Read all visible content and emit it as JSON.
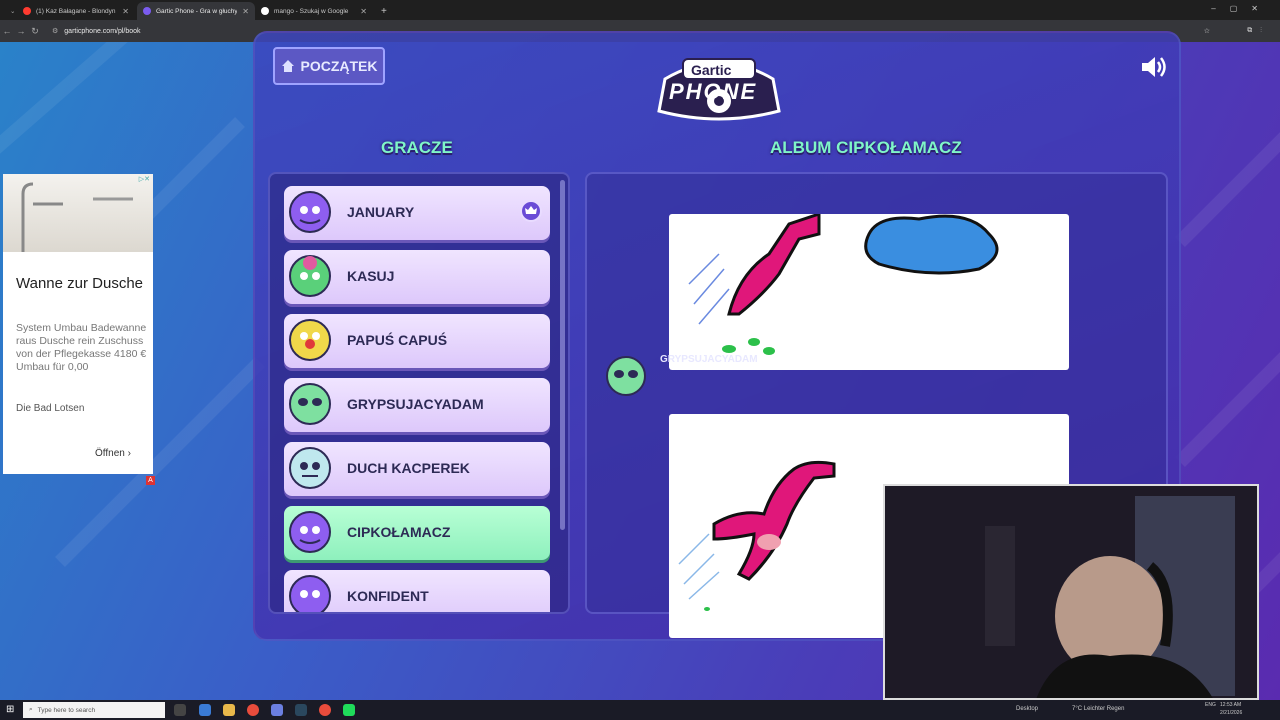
{
  "browser": {
    "tabs": [
      {
        "title": "(1) Kaz Bałagane - Blondyn",
        "color": "#ff3b30"
      },
      {
        "title": "Gartic Phone - Gra w głuchy te",
        "color": "#7b5cf0"
      },
      {
        "title": "mango - Szukaj w Google",
        "color": "#ffffff"
      }
    ],
    "new_tab": "+",
    "url": "garticphone.com/pl/book"
  },
  "game": {
    "home_label": "POCZĄTEK",
    "logo_top": "Gartic",
    "logo_bottom": "PHONE",
    "players_title": "GRACZE",
    "album_title": "ALBUM CIPKOŁAMACZ",
    "players": [
      {
        "name": "JANUARY",
        "avatar_color": "#8e5ef0",
        "host": true
      },
      {
        "name": "KASUJ",
        "avatar_color": "#5ad07a"
      },
      {
        "name": "PAPUŚ CAPUŚ",
        "avatar_color": "#f0d84a"
      },
      {
        "name": "GRYPSUJACYADAM",
        "avatar_color": "#7ee0a0"
      },
      {
        "name": "DUCH KACPEREK",
        "avatar_color": "#bfe8ee"
      },
      {
        "name": "CIPKOŁAMACZ",
        "avatar_color": "#8e5ef0",
        "selected": true
      },
      {
        "name": "KONFIDENT",
        "avatar_color": "#8e5ef0"
      }
    ],
    "album_author": "GRYPSUJACYADAM"
  },
  "ad": {
    "headline": "Wanne zur Dusche",
    "body": "System Umbau Badewanne raus Dusche rein Zuschuss von der Pflegekasse 4180 € Umbau für 0,00",
    "sponsor": "Die Bad Lotsen",
    "cta": "Öffnen"
  },
  "taskbar": {
    "search_placeholder": "Type here to search",
    "desktop_label": "Desktop",
    "weather": "7°C  Leichter Regen",
    "lang": "ENG",
    "time": "12:53 AM",
    "date": "2/21/2026"
  }
}
